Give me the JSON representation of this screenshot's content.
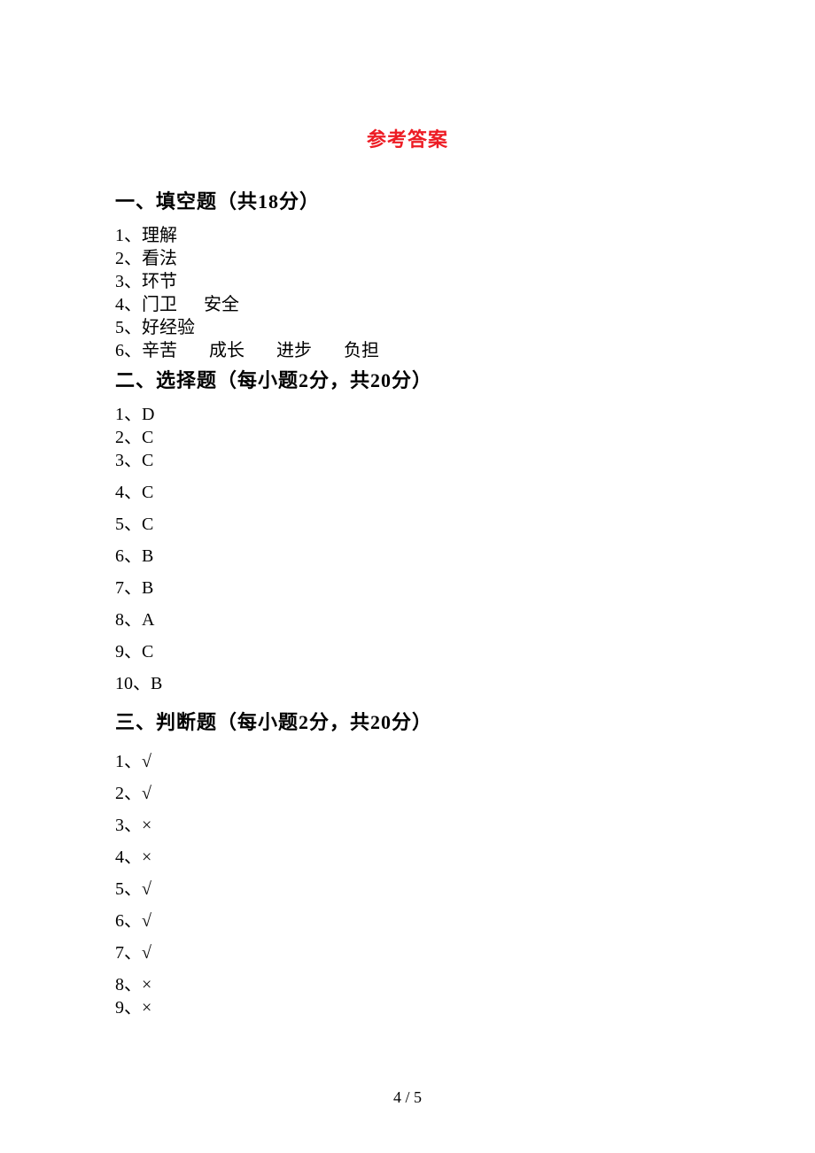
{
  "title": "参考答案",
  "sections": {
    "s1": {
      "heading": "一、填空题（共18分）",
      "answers": {
        "a1": "1、理解",
        "a2": "2、看法",
        "a3": "3、环节",
        "a4_num": "4、",
        "a4_p1": "门卫",
        "a4_p2": "安全",
        "a5": "5、好经验",
        "a6_num": "6、",
        "a6_p1": "辛苦",
        "a6_p2": "成长",
        "a6_p3": "进步",
        "a6_p4": "负担"
      }
    },
    "s2": {
      "heading": "二、选择题（每小题2分，共20分）",
      "answers": {
        "a1": "1、D",
        "a2": "2、C",
        "a3": "3、C",
        "a4": "4、C",
        "a5": "5、C",
        "a6": "6、B",
        "a7": "7、B",
        "a8": "8、A",
        "a9": "9、C",
        "a10": "10、B"
      }
    },
    "s3": {
      "heading": "三、判断题（每小题2分，共20分）",
      "answers": {
        "a1": "1、√",
        "a2": "2、√",
        "a3": "3、×",
        "a4": "4、×",
        "a5": "5、√",
        "a6": "6、√",
        "a7": "7、√",
        "a8": "8、×",
        "a9": "9、×"
      }
    }
  },
  "footer": "4 / 5"
}
